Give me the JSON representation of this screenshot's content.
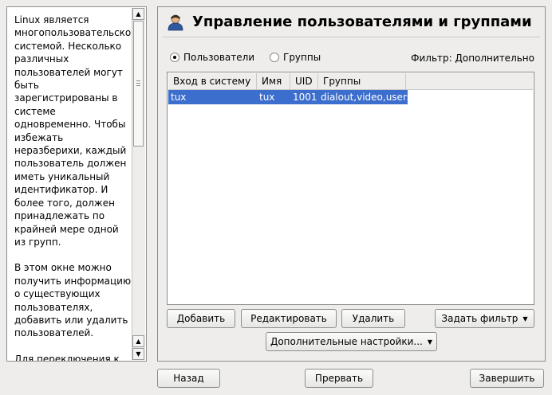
{
  "help": {
    "paragraphs": [
      "Linux является многопользовательской системой. Несколько различных пользователей могут быть зарегистрированы в системе одновременно. Чтобы избежать неразберихи, каждый пользователь должен иметь уникальный идентификатор. И более того, должен принадлежать по крайней мере одной из групп.",
      "В этом окне можно получить информацию о существующих пользователях, добавить или удалить пользователей.",
      "Для переключения к диалогу групп, нажмите"
    ],
    "scroll_up": "▲",
    "scroll_down": "▼"
  },
  "header": {
    "icon": "user-icon",
    "title": "Управление пользователями и группами"
  },
  "view": {
    "users_label": "Пользователи",
    "groups_label": "Группы",
    "selected": "users",
    "filter_text": "Фильтр: Дополнительно"
  },
  "table": {
    "columns": [
      "Вход в систему",
      "Имя",
      "UID",
      "Группы"
    ],
    "rows": [
      [
        "tux",
        "tux",
        "1001",
        "dialout,video,users"
      ]
    ],
    "selected_row": 0
  },
  "actions": {
    "add": "Добавить",
    "edit": "Редактировать",
    "delete": "Удалить",
    "set_filter": "Задать фильтр",
    "advanced": "Дополнительные настройки..."
  },
  "footer": {
    "back": "Назад",
    "abort": "Прервать",
    "finish": "Завершить"
  },
  "colors": {
    "selection": "#3c6ecd",
    "background": "#eeedeb"
  }
}
